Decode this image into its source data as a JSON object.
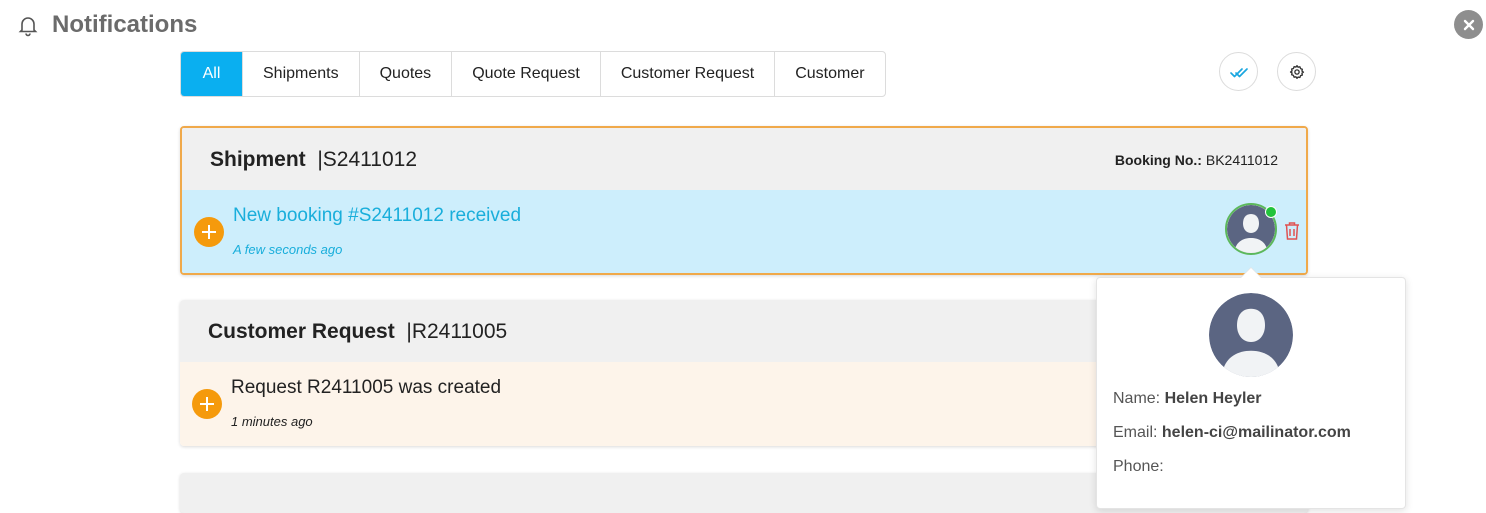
{
  "header": {
    "title": "Notifications",
    "icons": [
      "bell-icon",
      "close-icon"
    ]
  },
  "tabs": [
    {
      "label": "All",
      "active": true
    },
    {
      "label": "Shipments",
      "active": false
    },
    {
      "label": "Quotes",
      "active": false
    },
    {
      "label": "Quote Request",
      "active": false
    },
    {
      "label": "Customer Request",
      "active": false
    },
    {
      "label": "Customer",
      "active": false
    }
  ],
  "actions": {
    "icons": [
      "double-check-icon",
      "gear-icon"
    ]
  },
  "notifications": [
    {
      "type": "Shipment",
      "id": "|S2411012",
      "booking_label": "Booking No.:",
      "booking_value": "BK2411012",
      "message": "New booking #S2411012 received",
      "time": "A few seconds ago",
      "selected": true,
      "body_color": "#cdeefc",
      "text_color": "#19aedb"
    },
    {
      "type": "Customer Request",
      "id": "|R2411005",
      "message": "Request R2411005 was created",
      "time": "1 minutes ago",
      "selected": false,
      "body_color": "#fdf4ea",
      "text_color": "#222222"
    }
  ],
  "popup": {
    "name_label": "Name:",
    "name_value": "Helen Heyler",
    "email_label": "Email:",
    "email_value": "helen-ci@mailinator.com",
    "phone_label": "Phone:",
    "phone_value": ""
  },
  "colors": {
    "accent": "#0aaff0",
    "plus": "#f59a0c",
    "selected_border": "#f0a94a",
    "online": "#22c33b",
    "trash": "#e05252"
  }
}
